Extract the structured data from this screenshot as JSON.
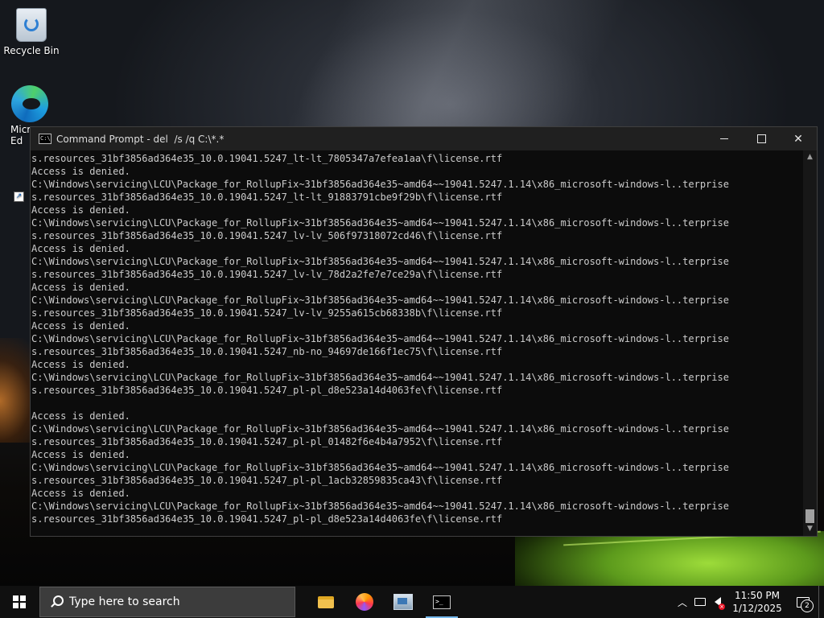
{
  "desktop": {
    "icons": [
      {
        "label": "Recycle Bin"
      },
      {
        "label": "Micro\nEd"
      }
    ]
  },
  "window": {
    "title": "Command Prompt - del  /s /q C:\\*.*",
    "lines": [
      "s.resources_31bf3856ad364e35_10.0.19041.5247_lt-lt_7805347a7efea1aa\\f\\license.rtf",
      "Access is denied.",
      "C:\\Windows\\servicing\\LCU\\Package_for_RollupFix~31bf3856ad364e35~amd64~~19041.5247.1.14\\x86_microsoft-windows-l..terprise",
      "s.resources_31bf3856ad364e35_10.0.19041.5247_lt-lt_91883791cbe9f29b\\f\\license.rtf",
      "Access is denied.",
      "C:\\Windows\\servicing\\LCU\\Package_for_RollupFix~31bf3856ad364e35~amd64~~19041.5247.1.14\\x86_microsoft-windows-l..terprise",
      "s.resources_31bf3856ad364e35_10.0.19041.5247_lv-lv_506f97318072cd46\\f\\license.rtf",
      "Access is denied.",
      "C:\\Windows\\servicing\\LCU\\Package_for_RollupFix~31bf3856ad364e35~amd64~~19041.5247.1.14\\x86_microsoft-windows-l..terprise",
      "s.resources_31bf3856ad364e35_10.0.19041.5247_lv-lv_78d2a2fe7e7ce29a\\f\\license.rtf",
      "Access is denied.",
      "C:\\Windows\\servicing\\LCU\\Package_for_RollupFix~31bf3856ad364e35~amd64~~19041.5247.1.14\\x86_microsoft-windows-l..terprise",
      "s.resources_31bf3856ad364e35_10.0.19041.5247_lv-lv_9255a615cb68338b\\f\\license.rtf",
      "Access is denied.",
      "C:\\Windows\\servicing\\LCU\\Package_for_RollupFix~31bf3856ad364e35~amd64~~19041.5247.1.14\\x86_microsoft-windows-l..terprise",
      "s.resources_31bf3856ad364e35_10.0.19041.5247_nb-no_94697de166f1ec75\\f\\license.rtf",
      "Access is denied.",
      "C:\\Windows\\servicing\\LCU\\Package_for_RollupFix~31bf3856ad364e35~amd64~~19041.5247.1.14\\x86_microsoft-windows-l..terprise",
      "s.resources_31bf3856ad364e35_10.0.19041.5247_pl-pl_d8e523a14d4063fe\\f\\license.rtf",
      "",
      "Access is denied.",
      "C:\\Windows\\servicing\\LCU\\Package_for_RollupFix~31bf3856ad364e35~amd64~~19041.5247.1.14\\x86_microsoft-windows-l..terprise",
      "s.resources_31bf3856ad364e35_10.0.19041.5247_pl-pl_01482f6e4b4a7952\\f\\license.rtf",
      "Access is denied.",
      "C:\\Windows\\servicing\\LCU\\Package_for_RollupFix~31bf3856ad364e35~amd64~~19041.5247.1.14\\x86_microsoft-windows-l..terprise",
      "s.resources_31bf3856ad364e35_10.0.19041.5247_pl-pl_1acb32859835ca43\\f\\license.rtf",
      "Access is denied.",
      "C:\\Windows\\servicing\\LCU\\Package_for_RollupFix~31bf3856ad364e35~amd64~~19041.5247.1.14\\x86_microsoft-windows-l..terprise",
      "s.resources_31bf3856ad364e35_10.0.19041.5247_pl-pl_d8e523a14d4063fe\\f\\license.rtf"
    ]
  },
  "taskbar": {
    "search_placeholder": "Type here to search",
    "apps": [
      {
        "icon": "file-explorer-icon"
      },
      {
        "icon": "firefox-icon"
      },
      {
        "icon": "control-panel-icon"
      },
      {
        "icon": "command-prompt-icon",
        "active": true
      }
    ],
    "clock": {
      "time": "11:50 PM",
      "date": "1/12/2025"
    },
    "notification_count": "2"
  },
  "colors": {
    "console_bg": "#0c0c0c",
    "console_text": "#cccccc",
    "taskbar_bg": "#101010",
    "active_indicator": "#76b9ed"
  }
}
